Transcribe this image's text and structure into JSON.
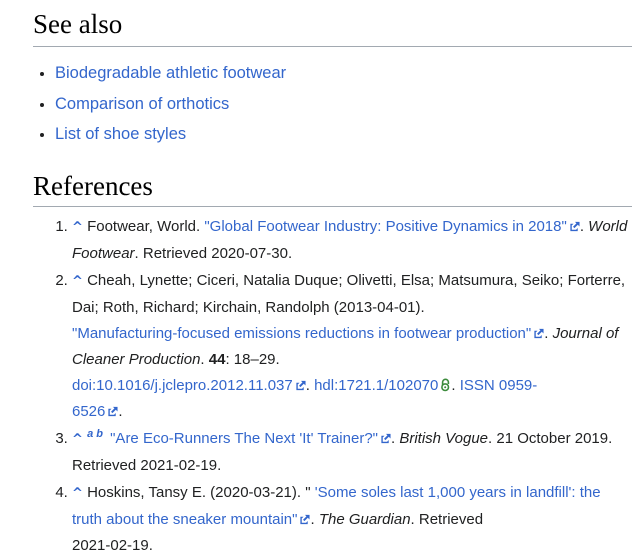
{
  "colors": {
    "background": "#ffffff",
    "text": "#202122",
    "link": "#3366cc",
    "heading_rule": "#a2a9b1",
    "open_access_green": "#3c8b3c"
  },
  "see_also": {
    "heading": "See also",
    "links": [
      "Biodegradable athletic footwear",
      "Comparison of orthotics",
      "List of shoe styles"
    ]
  },
  "references": {
    "heading": "References",
    "items": [
      {
        "number": "1.",
        "segments": [
          {
            "t": "caret",
            "v": "^"
          },
          {
            "t": "text",
            "v": " Footwear, World. "
          },
          {
            "t": "link",
            "v": "\"Global Footwear Industry: Positive Dynamics in 2018\"",
            "nobr": true,
            "ext": true
          },
          {
            "t": "text",
            "v": ". "
          },
          {
            "t": "italic",
            "v": "World Footwear"
          },
          {
            "t": "text",
            "v": ". Retrieved 2020-07-30."
          }
        ]
      },
      {
        "number": "2.",
        "segments": [
          {
            "t": "caret",
            "v": "^"
          },
          {
            "t": "text",
            "v": " Cheah, Lynette; Ciceri, Natalia Duque; Olivetti, Elsa; Matsumura, Seiko; Forterre, Dai; Roth, Richard; Kirchain, Randolph (2013-04-01). "
          },
          {
            "t": "link",
            "v": "\"Manufacturing-focused emissions reductions in footwear production\"",
            "nobr": true,
            "ext": true
          },
          {
            "t": "text",
            "v": ". "
          },
          {
            "t": "italic",
            "v": "Journal of Cleaner Production"
          },
          {
            "t": "text",
            "v": ". "
          },
          {
            "t": "bold",
            "v": "44"
          },
          {
            "t": "text",
            "v": ": 18–29. "
          },
          {
            "t": "br"
          },
          {
            "t": "link",
            "v": "doi:10.1016/j.jclepro.2012.11.037",
            "nobr": true,
            "ext": true
          },
          {
            "t": "text",
            "v": ". "
          },
          {
            "t": "link",
            "v": "hdl:1721.1/102070",
            "nobr": true,
            "lock": true
          },
          {
            "t": "text",
            "v": ". "
          },
          {
            "t": "link",
            "v": "ISSN 0959-",
            "nobr": true
          },
          {
            "t": "br"
          },
          {
            "t": "link",
            "v": "6526",
            "nobr": true,
            "ext": true
          },
          {
            "t": "text",
            "v": "."
          }
        ]
      },
      {
        "number": "3.",
        "segments": [
          {
            "t": "caret",
            "v": "^"
          },
          {
            "t": "text",
            "v": " "
          },
          {
            "t": "suplink",
            "v": "a"
          },
          {
            "t": "suplink",
            "v": "b"
          },
          {
            "t": "text",
            "v": " "
          },
          {
            "t": "link",
            "v": "\"Are Eco-Runners The Next 'It' Trainer?\"",
            "nobr": true,
            "ext": true
          },
          {
            "t": "text",
            "v": ". "
          },
          {
            "t": "italic",
            "v": "British Vogue"
          },
          {
            "t": "text",
            "v": ". 21 October 2019. Retrieved 2021-02-19."
          }
        ]
      },
      {
        "number": "4.",
        "segments": [
          {
            "t": "caret",
            "v": "^"
          },
          {
            "t": "text",
            "v": " Hoskins, Tansy E. (2020-03-21). \""
          },
          {
            "t": "link",
            "v": " 'Some soles last 1,000 years in landfill': the truth about the sneaker mountain\"",
            "ext": true
          },
          {
            "t": "text",
            "v": ". "
          },
          {
            "t": "italic",
            "v": "The Guardian"
          },
          {
            "t": "text",
            "v": ". Retrieved"
          },
          {
            "t": "br"
          },
          {
            "t": "text",
            "v": "2021-02-19."
          }
        ]
      }
    ]
  }
}
